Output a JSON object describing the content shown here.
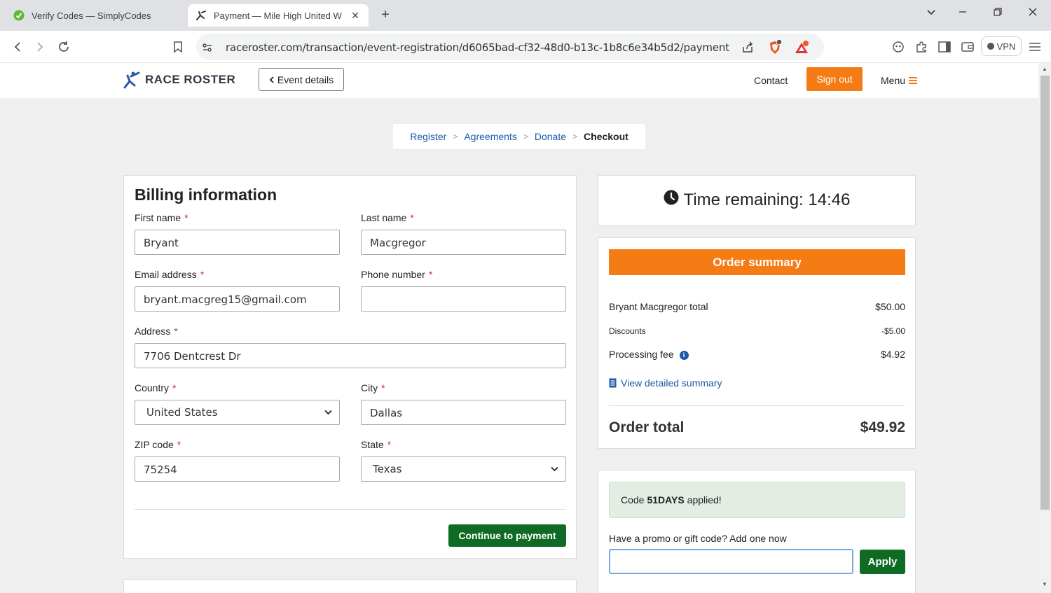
{
  "browser": {
    "tabs": [
      {
        "title": "Verify Codes — SimplyCodes",
        "active": false
      },
      {
        "title": "Payment — Mile High United W",
        "active": true
      }
    ],
    "url": "raceroster.com/transaction/event-registration/d6065bad-cf32-48d0-b13c-1b8c6e34b5d2/payment",
    "brave_badge": "5",
    "rewards_badge": "1",
    "vpn_label": "VPN"
  },
  "header": {
    "logo_text": "RACE ROSTER",
    "event_details_label": "Event details",
    "contact_label": "Contact",
    "signout_label": "Sign out",
    "menu_label": "Menu"
  },
  "breadcrumb": {
    "items": [
      "Register",
      "Agreements",
      "Donate"
    ],
    "current": "Checkout"
  },
  "billing": {
    "title": "Billing information",
    "first_name": {
      "label": "First name",
      "value": "Bryant"
    },
    "last_name": {
      "label": "Last name",
      "value": "Macgregor"
    },
    "email": {
      "label": "Email address",
      "value": "bryant.macgreg15@gmail.com"
    },
    "phone": {
      "label": "Phone number",
      "value": ""
    },
    "address": {
      "label": "Address",
      "value": "7706 Dentcrest Dr"
    },
    "country": {
      "label": "Country",
      "value": "United States"
    },
    "city": {
      "label": "City",
      "value": "Dallas"
    },
    "zip": {
      "label": "ZIP code",
      "value": "75254"
    },
    "state": {
      "label": "State",
      "value": "Texas"
    },
    "required_mark": "*",
    "continue_label": "Continue to payment"
  },
  "timer": {
    "text": "Time remaining: 14:46"
  },
  "summary": {
    "title": "Order summary",
    "rows": [
      {
        "label": "Bryant Macgregor total",
        "value": "$50.00"
      },
      {
        "label": "Discounts",
        "value": "-$5.00"
      },
      {
        "label": "Processing fee",
        "value": "$4.92"
      }
    ],
    "info_glyph": "i",
    "detail_link": "View detailed summary",
    "total_label": "Order total",
    "total_value": "$49.92"
  },
  "promo": {
    "success_prefix": "Code",
    "success_code": "51DAYS",
    "success_suffix": "applied!",
    "label": "Have a promo or gift code? Add one now",
    "input_value": "",
    "apply_label": "Apply"
  },
  "colors": {
    "brand_orange": "#f57c14",
    "action_green": "#0f6b23",
    "link_blue": "#1d5aa8"
  }
}
